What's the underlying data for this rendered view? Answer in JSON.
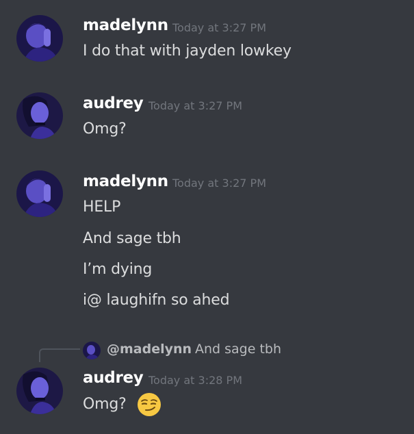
{
  "messages": [
    {
      "author": "madelynn",
      "timestamp": "Today at 3:27 PM",
      "avatar_icon": "madelynn-avatar",
      "lines": [
        "I do that with jayden lowkey"
      ]
    },
    {
      "author": "audrey",
      "timestamp": "Today at 3:27 PM",
      "avatar_icon": "audrey-avatar",
      "lines": [
        "Omg?"
      ]
    },
    {
      "author": "madelynn",
      "timestamp": "Today at 3:27 PM",
      "avatar_icon": "madelynn-avatar",
      "lines": [
        "HELP",
        "And sage tbh",
        "I’m dying",
        "i@ laughifn so ahed"
      ]
    },
    {
      "reply": {
        "mention": "@madelynn",
        "text": "And sage tbh"
      },
      "author": "audrey",
      "timestamp": "Today at 3:28 PM",
      "avatar_icon": "audrey-avatar",
      "lines": [
        "Omg?"
      ],
      "emoji": "smirking-face"
    }
  ],
  "colors": {
    "background": "#36393f",
    "username": "#ffffff",
    "timestamp": "#72767d",
    "message_text": "#dcddde"
  }
}
